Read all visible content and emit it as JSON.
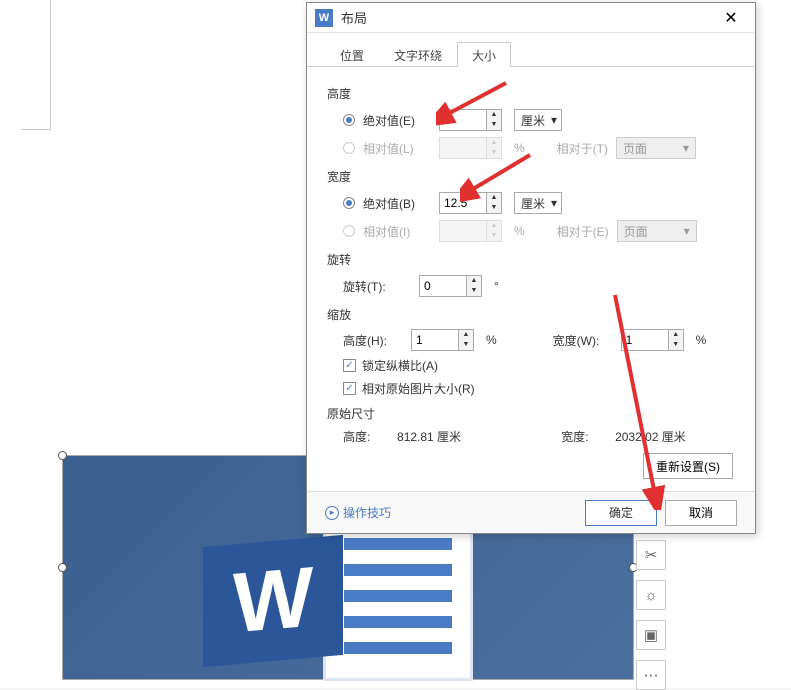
{
  "dialog": {
    "title": "布局",
    "tabs": {
      "t1": "位置",
      "t2": "文字环绕",
      "t3": "大小"
    },
    "height": {
      "label": "高度",
      "abs_label": "绝对值(E)",
      "abs_value": "5",
      "abs_unit": "厘米",
      "rel_label": "相对值(L)",
      "rel_value": "",
      "rel_unit": "%",
      "rel_to_label": "相对于(T)",
      "rel_to_value": "页面"
    },
    "width": {
      "label": "宽度",
      "abs_label": "绝对值(B)",
      "abs_value": "12.5",
      "abs_unit": "厘米",
      "rel_label": "相对值(I)",
      "rel_value": "",
      "rel_unit": "%",
      "rel_to_label": "相对于(E)",
      "rel_to_value": "页面"
    },
    "rotation": {
      "label": "旋转",
      "field_label": "旋转(T):",
      "value": "0",
      "unit": "°"
    },
    "scale": {
      "label": "缩放",
      "h_label": "高度(H):",
      "h_value": "1",
      "h_unit": "%",
      "w_label": "宽度(W):",
      "w_value": "1",
      "w_unit": "%",
      "lock_label": "锁定纵横比(A)",
      "relpic_label": "相对原始图片大小(R)"
    },
    "original": {
      "label": "原始尺寸",
      "h_label": "高度:",
      "h_value": "812.81 厘米",
      "w_label": "宽度:",
      "w_value": "2032.02 厘米"
    },
    "reset": "重新设置(S)",
    "tips": "操作技巧",
    "ok": "确定",
    "cancel": "取消"
  }
}
